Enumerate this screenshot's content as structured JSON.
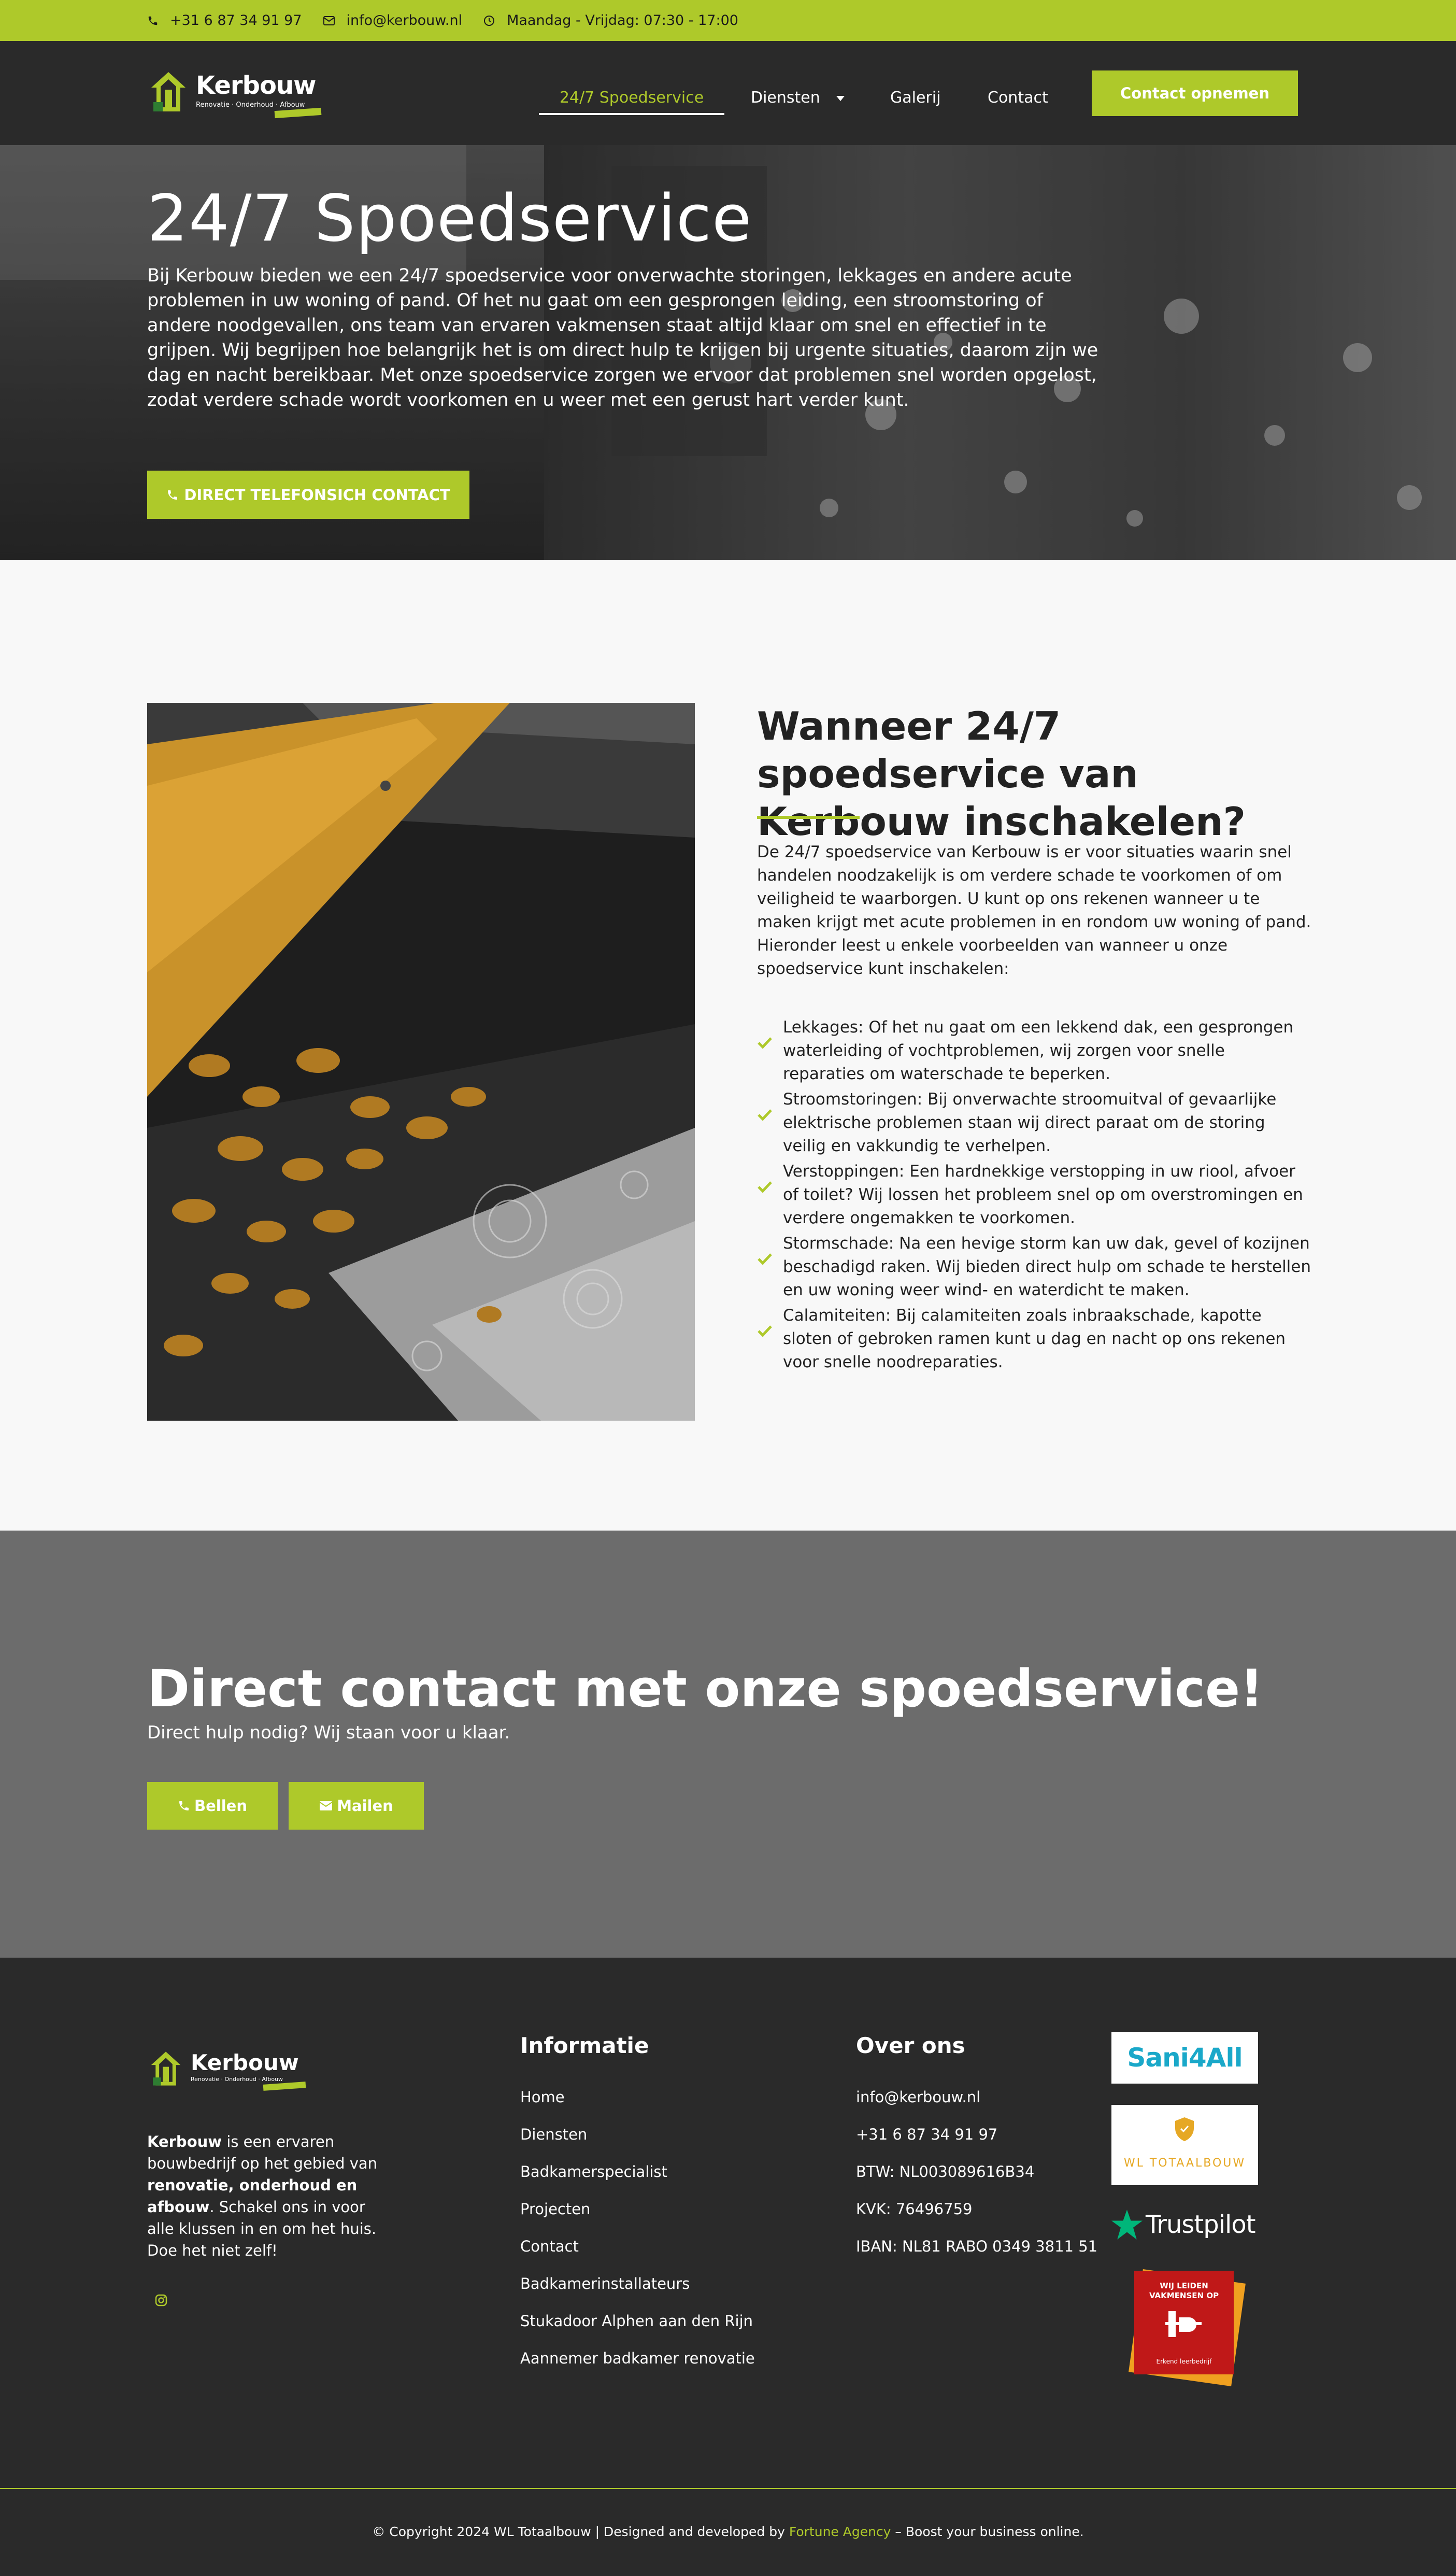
{
  "topbar": {
    "phone": "+31 6 87 34 91 97",
    "email": "info@kerbouw.nl",
    "hours": "Maandag - Vrijdag: 07:30 - 17:00"
  },
  "header": {
    "logo_name": "Kerbouw",
    "logo_tagline": "Renovatie  ·  Onderhoud  ·  Afbouw",
    "nav": [
      "24/7 Spoedservice",
      "Diensten",
      "Galerij",
      "Contact"
    ],
    "cta": "Contact opnemen"
  },
  "hero": {
    "title": "24/7 Spoedservice",
    "body": "Bij Kerbouw bieden we een 24/7 spoedservice voor onverwachte storingen, lekkages en andere acute problemen in uw woning of pand. Of het nu gaat om een gesprongen leiding, een stroomstoring of andere noodgevallen, ons team van ervaren vakmensen staat altijd klaar om snel en effectief in te grijpen. Wij begrijpen hoe belangrijk het is om direct hulp te krijgen bij urgente situaties, daarom zijn we dag en nacht bereikbaar. Met onze spoedservice zorgen we ervoor dat problemen snel worden opgelost, zodat verdere schade wordt voorkomen en u weer met een gerust hart verder kunt.",
    "button": "DIRECT TELEFONSICH CONTACT"
  },
  "when": {
    "title": "Wanneer 24/7 spoedservice van Kerbouw inschakelen?",
    "intro": "De 24/7 spoedservice van Kerbouw is er voor situaties waarin snel handelen noodzakelijk is om verdere schade te voorkomen of om veiligheid te waarborgen. U kunt op ons rekenen wanneer u te maken krijgt met acute problemen in en rondom uw woning of pand. Hieronder leest u enkele voorbeelden van wanneer u onze spoedservice kunt inschakelen:",
    "items": [
      "Lekkages: Of het nu gaat om een lekkend dak, een gesprongen waterleiding of vochtproblemen, wij zorgen voor snelle reparaties om waterschade te beperken.",
      "Stroomstoringen: Bij onverwachte stroomuitval of gevaarlijke elektrische problemen staan wij direct paraat om de storing veilig en vakkundig te verhelpen.",
      "Verstoppingen: Een hardnekkige verstopping in uw riool, afvoer of toilet? Wij lossen het probleem snel op om overstromingen en verdere ongemakken te voorkomen.",
      "Stormschade: Na een hevige storm kan uw dak, gevel of kozijnen beschadigd raken. Wij bieden direct hulp om schade te herstellen en uw woning weer wind- en waterdicht te maken.",
      "Calamiteiten: Bij calamiteiten zoals inbraakschade, kapotte sloten of gebroken ramen kunt u dag en nacht op ons rekenen voor snelle noodreparaties."
    ]
  },
  "contact": {
    "title": "Direct contact met onze spoedservice!",
    "subtitle": "Direct hulp nodig? Wij staan voor u klaar.",
    "call": "Bellen",
    "mail": "Mailen"
  },
  "footer": {
    "logo_name": "Kerbouw",
    "about_b1": "Kerbouw",
    "about_t1": " is een ervaren bouwbedrijf op het gebied van ",
    "about_b2": "renovatie, onderhoud en afbouw",
    "about_t2": ". Schakel ons in voor alle klussen in en om het huis. Doe het niet zelf!",
    "info_title": "Informatie",
    "info_links": [
      "Home",
      "Diensten",
      "Badkamerspecialist",
      "Projecten",
      "Contact",
      "Badkamerinstallateurs",
      "Stukadoor Alphen aan den Rijn",
      "Aannemer badkamer renovatie"
    ],
    "about_title": "Over ons",
    "about_lines": [
      "info@kerbouw.nl",
      "+31 6 87 34 91 97",
      "BTW: NL003089616B34",
      "KVK: 76496759",
      "IBAN: NL81 RABO 0349 3811 51"
    ],
    "badges": {
      "sani": "Sani4All",
      "wl": "WL TOTAALBOUW",
      "trustpilot": "Trustpilot",
      "leiden_top": "WIJ LEIDEN VAKMENSEN OP",
      "leiden_bottom": "Erkend leerbedrijf"
    },
    "copyright_pre": "© Copyright 2024 WL Totaalbouw | Designed and developed by ",
    "copyright_link": "Fortune Agency",
    "copyright_post": " – Boost your business online."
  },
  "colors": {
    "accent": "#aec92a",
    "dark": "#2a2a2a",
    "grey": "#6c6c6c"
  }
}
